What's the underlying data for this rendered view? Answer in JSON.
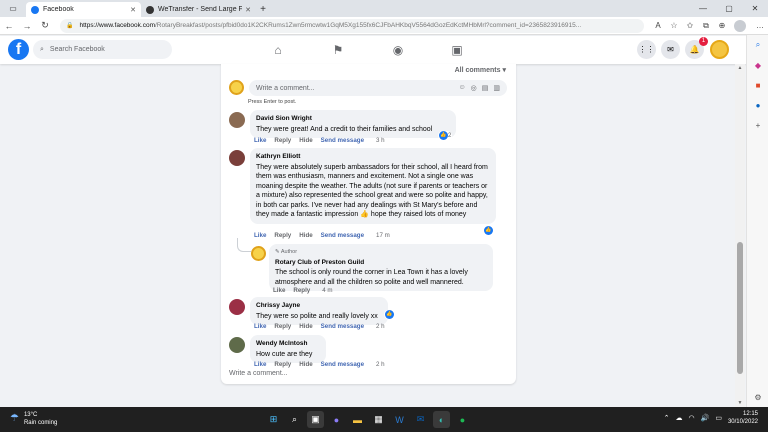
{
  "browser": {
    "tabs": [
      {
        "title": "Facebook",
        "color": "#1877f2",
        "active": true
      },
      {
        "title": "WeTransfer - Send Large Files &",
        "color": "#333333",
        "active": false
      }
    ],
    "url_host": "https://www.facebook.com",
    "url_path": "/RotaryBreakfast/posts/pfbid0do1K2CKRums1Zwn5rmcwtw1GqM5Xg155fx6CJFbAHKbqV5564dGozEdKctMHbMrl?comment_id=2365823916915..."
  },
  "fb": {
    "search_placeholder": "Search Facebook",
    "notif_count": "1",
    "all_comments": "All comments",
    "write_placeholder": "Write a comment...",
    "press_enter": "Press Enter to post.",
    "write_bottom": "Write a comment..."
  },
  "comments": [
    {
      "author": "David Sion Wright",
      "text": "They were great! And a credit to their families and school",
      "like": "Like",
      "reply": "Reply",
      "hide": "Hide",
      "send": "Send message",
      "time": "3 h",
      "react_count": "2"
    },
    {
      "author": "Kathryn Elliott",
      "text": "They were absolutely superb ambassadors for their school, all I heard from them was enthusiasm, manners and excitement. Not a single one was moaning despite the weather. The adults (not sure if parents or teachers or a mixture) also represented the school great and were so polite and happy, in both car parks. I've never had any dealings with St Mary's before and they made a fantastic impression 👍 hope they raised lots of money",
      "like": "Like",
      "reply": "Reply",
      "hide": "Hide",
      "send": "Send message",
      "time": "17 m"
    },
    {
      "role": "Author",
      "author": "Rotary Club of Preston Guild",
      "text": "The school is only round the corner in Lea Town it has a lovely atmosphere and all the children so polite and well mannered.",
      "like": "Like",
      "reply": "Reply",
      "time": "4 m"
    },
    {
      "author": "Chrissy Jayne",
      "text": "They were so polite and really lovely xx",
      "like": "Like",
      "reply": "Reply",
      "hide": "Hide",
      "send": "Send message",
      "time": "2 h"
    },
    {
      "author": "Wendy McIntosh",
      "text": "How cute are they",
      "like": "Like",
      "reply": "Reply",
      "hide": "Hide",
      "send": "Send message",
      "time": "2 h"
    }
  ],
  "taskbar": {
    "temp": "13°C",
    "weather": "Rain coming",
    "time": "12:15",
    "date": "30/10/2022"
  }
}
